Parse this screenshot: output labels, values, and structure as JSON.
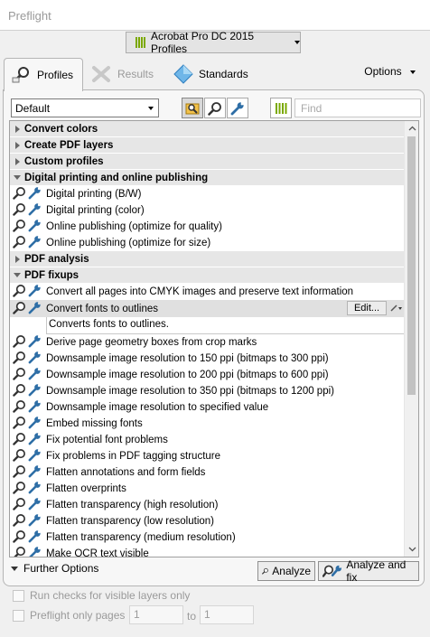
{
  "window": {
    "title": "Preflight"
  },
  "profile_set": {
    "label": "Acrobat Pro DC 2015 Profiles"
  },
  "tabs": [
    {
      "label": "Profiles"
    },
    {
      "label": "Results"
    },
    {
      "label": "Standards"
    }
  ],
  "options": {
    "label": "Options"
  },
  "toolbar": {
    "profile_filter": "Default",
    "find_placeholder": "Find"
  },
  "categories": [
    {
      "label": "Convert colors",
      "expanded": false
    },
    {
      "label": "Create PDF layers",
      "expanded": false
    },
    {
      "label": "Custom profiles",
      "expanded": false
    },
    {
      "label": "Digital printing and online publishing",
      "expanded": true,
      "items": [
        "Digital printing (B/W)",
        "Digital printing (color)",
        "Online publishing (optimize for quality)",
        "Online publishing (optimize for size)"
      ]
    },
    {
      "label": "PDF analysis",
      "expanded": false
    },
    {
      "label": "PDF fixups",
      "expanded": true,
      "items": [
        "Convert all pages into CMYK images and preserve text information",
        "Convert fonts to outlines",
        "Derive page geometry boxes from crop marks",
        "Downsample image resolution to 150 ppi (bitmaps to 300 ppi)",
        "Downsample image resolution to 200 ppi (bitmaps to 600 ppi)",
        "Downsample image resolution to 350 ppi (bitmaps to 1200 ppi)",
        "Downsample image resolution to specified value",
        "Embed missing fonts",
        "Fix potential font problems",
        "Fix problems in PDF tagging structure",
        "Flatten annotations and form fields",
        "Flatten overprints",
        "Flatten transparency (high resolution)",
        "Flatten transparency (low resolution)",
        "Flatten transparency (medium resolution)",
        "Make OCR text visible"
      ]
    }
  ],
  "selected": {
    "label": "Convert fonts to outlines",
    "edit_label": "Edit...",
    "description": "Converts fonts to outlines."
  },
  "bottom": {
    "further_options": "Further Options",
    "analyze": "Analyze",
    "analyze_fix": "Analyze and fix",
    "check_visible_layers": "Run checks for visible layers only",
    "preflight_only_pages": "Preflight only pages",
    "page_from": "1",
    "to_label": "to",
    "page_to": "1"
  },
  "colors": {
    "accent_green": "#7aa800",
    "wrench_blue": "#2e6ea6",
    "selected_row": "#e0e0e0"
  }
}
